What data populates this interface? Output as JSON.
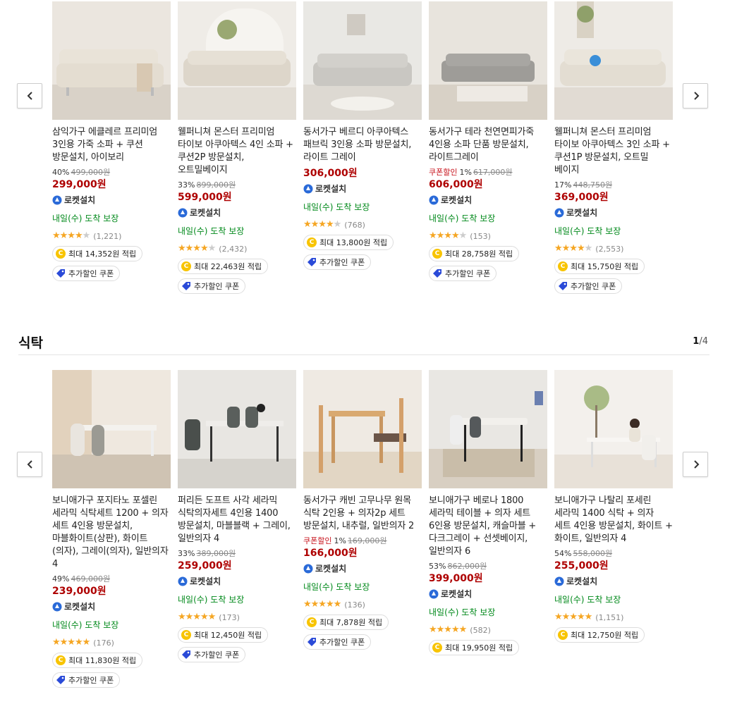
{
  "sections": {
    "sofa": {
      "products": [
        {
          "name": "삼익가구 에클레르 프리미엄 3인용 가죽 소파 + 쿠션 방문설치, 아이보리",
          "discount": "40%",
          "original": "499,000원",
          "price": "299,000원",
          "rocket": "로켓설치",
          "delivery": "내일(수) 도착 보장",
          "stars": 4.5,
          "reviews": "(1,221)",
          "points": "최대 14,352원 적립",
          "coupon": "추가할인 쿠폰"
        },
        {
          "name": "웰퍼니쳐 몬스터 프리미엄 타이보 아쿠아텍스 4인 소파 + 쿠션2P 방문설치, 오트밀베이지",
          "discount": "33%",
          "original": "899,000원",
          "price": "599,000원",
          "rocket": "로켓설치",
          "delivery": "내일(수) 도착 보장",
          "stars": 4.5,
          "reviews": "(2,432)",
          "points": "최대 22,463원 적립",
          "coupon": "추가할인 쿠폰"
        },
        {
          "name": "동서가구 베르디 아쿠아텍스 패브릭 3인용 소파 방문설치, 라이트 그레이",
          "discount": "",
          "original": "",
          "price": "306,000원",
          "rocket": "로켓설치",
          "delivery": "내일(수) 도착 보장",
          "stars": 4.5,
          "reviews": "(768)",
          "points": "최대 13,800원 적립",
          "coupon": "추가할인 쿠폰"
        },
        {
          "name": "동서가구 테라 천연면피가죽 4인용 소파 단품 방문설치, 라이트그레이",
          "couponSale": "쿠폰할인",
          "discount": "1%",
          "original": "617,000원",
          "price": "606,000원",
          "rocket": "로켓설치",
          "delivery": "내일(수) 도착 보장",
          "stars": 4.5,
          "reviews": "(153)",
          "points": "최대 28,758원 적립",
          "coupon": "추가할인 쿠폰"
        },
        {
          "name": "웰퍼니쳐 몬스터 프리미엄 타이보 아쿠아텍스 3인 소파 + 쿠션1P 방문설치, 오트밀 베이지",
          "discount": "17%",
          "original": "448,750원",
          "price": "369,000원",
          "rocket": "로켓설치",
          "delivery": "내일(수) 도착 보장",
          "stars": 4.5,
          "reviews": "(2,553)",
          "points": "최대 15,750원 적립",
          "coupon": "추가할인 쿠폰"
        }
      ]
    },
    "dining": {
      "title": "식탁",
      "page_current": "1",
      "page_total": "/4",
      "products": [
        {
          "name": "보니애가구 포지타노 포셀린 세라믹 식탁세트 1200 + 의자 세트 4인용 방문설치, 마블화이트(상판), 화이트(의자), 그레이(의자), 일반의자 4",
          "discount": "49%",
          "original": "469,000원",
          "price": "239,000원",
          "rocket": "로켓설치",
          "delivery": "내일(수) 도착 보장",
          "stars": 5,
          "reviews": "(176)",
          "points": "최대 11,830원 적립",
          "coupon": "추가할인 쿠폰"
        },
        {
          "name": "퍼리든 도프트 사각 세라믹 식탁의자세트 4인용 1400 방문설치, 마블블랙 + 그레이, 일반의자 4",
          "discount": "33%",
          "original": "389,000원",
          "price": "259,000원",
          "rocket": "로켓설치",
          "delivery": "내일(수) 도착 보장",
          "stars": 5,
          "reviews": "(173)",
          "points": "최대 12,450원 적립",
          "coupon": "추가할인 쿠폰"
        },
        {
          "name": "동서가구 캐빈 고무나무 원목 식탁 2인용 + 의자2p 세트 방문설치, 내추럴, 일반의자 2",
          "couponSale": "쿠폰할인",
          "discount": "1%",
          "original": "169,000원",
          "price": "166,000원",
          "rocket": "로켓설치",
          "delivery": "내일(수) 도착 보장",
          "stars": 5,
          "reviews": "(136)",
          "points": "최대 7,878원 적립",
          "coupon": "추가할인 쿠폰"
        },
        {
          "name": "보니애가구 베로나 1800 세라믹 테이블 + 의자 세트 6인용 방문설치, 캐슬마블 + 다크그레이 + 선셋베이지, 일반의자 6",
          "discount": "53%",
          "original": "862,000원",
          "price": "399,000원",
          "rocket": "로켓설치",
          "delivery": "내일(수) 도착 보장",
          "stars": 5,
          "reviews": "(582)",
          "points": "최대 19,950원 적립",
          "coupon": ""
        },
        {
          "name": "보니애가구 나탈리 포세린 세라믹 1400 식탁 + 의자 세트 4인용 방문설치, 화이트 + 화이트, 일반의자 4",
          "discount": "54%",
          "original": "558,000원",
          "price": "255,000원",
          "rocket": "로켓설치",
          "delivery": "내일(수) 도착 보장",
          "stars": 5,
          "reviews": "(1,151)",
          "points": "최대 12,750원 적립",
          "coupon": ""
        }
      ]
    }
  },
  "colors": {
    "price": "#ae0000",
    "delivery": "#00891a",
    "star": "#f5a623",
    "coin": "#f8c400",
    "rocket": "#2a6ad8"
  }
}
